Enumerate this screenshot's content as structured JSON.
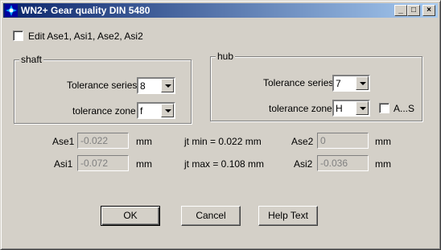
{
  "window": {
    "title": "WN2+ Gear quality DIN 5480"
  },
  "edit_checkbox_label": "Edit Ase1, Asi1, Ase2, Asi2",
  "shaft": {
    "title": "shaft",
    "tolerance_series_label": "Tolerance series",
    "tolerance_series_value": "8",
    "tolerance_zone_label": "tolerance zone",
    "tolerance_zone_value": "f"
  },
  "hub": {
    "title": "hub",
    "tolerance_series_label": "Tolerance series",
    "tolerance_series_value": "7",
    "tolerance_zone_label": "tolerance zone",
    "tolerance_zone_value": "H",
    "as_checkbox_label": "A...S"
  },
  "values": {
    "ase1_label": "Ase1",
    "ase1_value": "-0.022",
    "asi1_label": "Asi1",
    "asi1_value": "-0.072",
    "ase2_label": "Ase2",
    "ase2_value": "0",
    "asi2_label": "Asi2",
    "asi2_value": "-0.036",
    "unit": "mm",
    "jt_min": "jt min = 0.022 mm",
    "jt_max": "jt max = 0.108 mm"
  },
  "buttons": {
    "ok": "OK",
    "cancel": "Cancel",
    "help": "Help Text"
  },
  "titlebar_buttons": {
    "minimize": "_",
    "maximize": "□",
    "close": "×"
  }
}
